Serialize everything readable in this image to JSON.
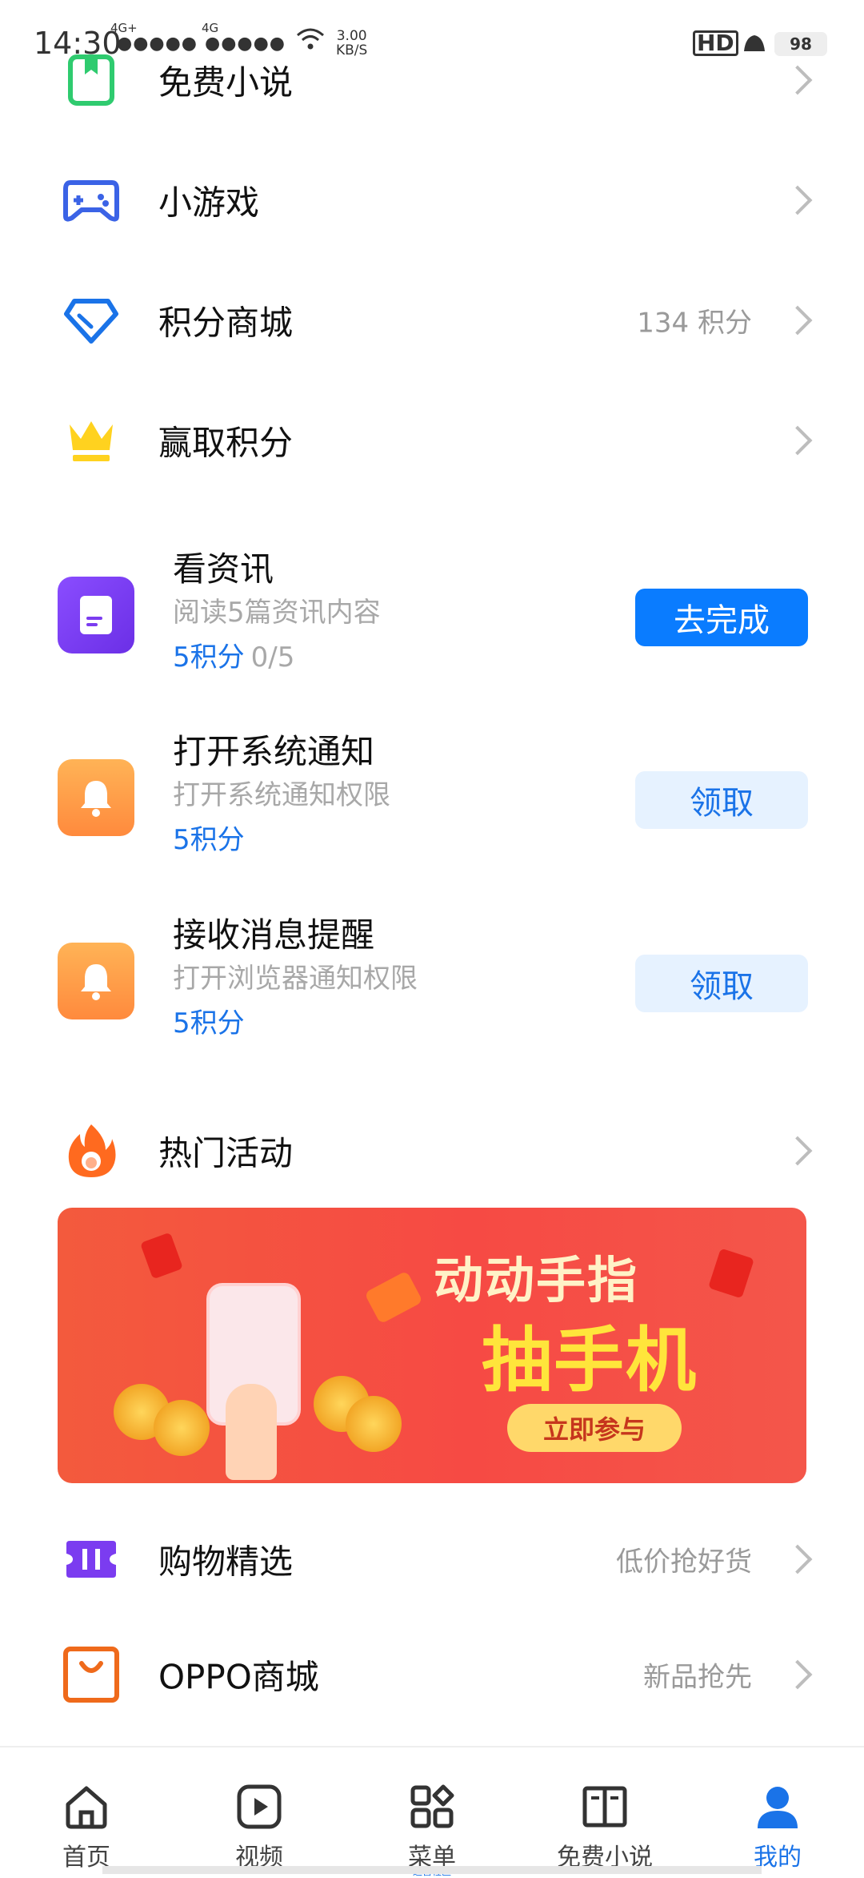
{
  "status_bar": {
    "time": "14:30",
    "net1": "4G+",
    "net2": "4G",
    "speed_top": "3.00",
    "speed_unit": "KB/S",
    "hd": "HD",
    "battery": "98"
  },
  "menu": [
    {
      "label": "免费小说",
      "icon": "bookmark-icon"
    },
    {
      "label": "小游戏",
      "icon": "gamepad-icon"
    },
    {
      "label": "积分商城",
      "icon": "diamond-icon",
      "value": "134 积分"
    },
    {
      "label": "赢取积分",
      "icon": "crown-icon"
    }
  ],
  "tasks": [
    {
      "title": "看资讯",
      "desc": "阅读5篇资讯内容",
      "points": "5积分",
      "progress": "0/5",
      "button": "去完成",
      "icon": "document-icon"
    },
    {
      "title": "打开系统通知",
      "desc": "打开系统通知权限",
      "points": "5积分",
      "button": "领取",
      "icon": "bell-icon"
    },
    {
      "title": "接收消息提醒",
      "desc": "打开浏览器通知权限",
      "points": "5积分",
      "button": "领取",
      "icon": "bell-icon"
    }
  ],
  "hot": {
    "label": "热门活动",
    "icon": "flame-icon"
  },
  "banner": {
    "line1": "动动手指",
    "line2": "抽手机",
    "cta": "立即参与"
  },
  "menu2": [
    {
      "label": "购物精选",
      "value": "低价抢好货",
      "icon": "ticket-icon"
    },
    {
      "label": "OPPO商城",
      "value": "新品抢先",
      "icon": "shopping-bag-icon"
    }
  ],
  "tabs": [
    {
      "label": "首页",
      "icon": "home-icon"
    },
    {
      "label": "视频",
      "icon": "play-icon"
    },
    {
      "label": "菜单",
      "icon": "grid-icon",
      "sub": "运营社区"
    },
    {
      "label": "免费小说",
      "icon": "book-icon"
    },
    {
      "label": "我的",
      "icon": "user-icon",
      "active": true
    }
  ],
  "colors": {
    "accent": "#1a73e8",
    "button_primary": "#0a7cff",
    "button_light": "#e6f2ff",
    "banner_red": "#f64a44"
  }
}
